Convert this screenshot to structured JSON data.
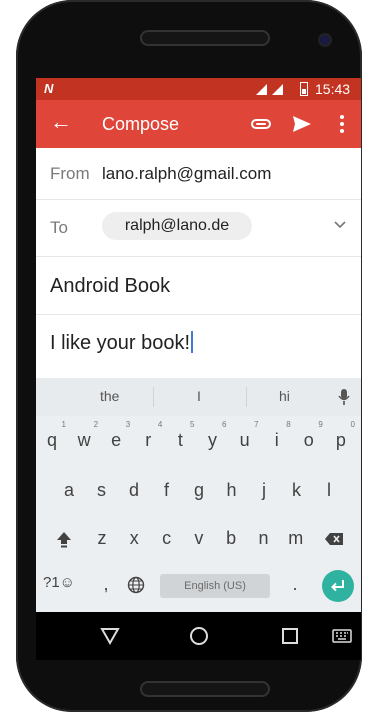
{
  "status_bar": {
    "notification": "N",
    "time": "15:43"
  },
  "app_bar": {
    "title": "Compose"
  },
  "compose": {
    "from_label": "From",
    "from_value": "lano.ralph@gmail.com",
    "to_label": "To",
    "to_chip": "ralph@lano.de",
    "subject": "Android Book",
    "body": "I like your book!"
  },
  "keyboard": {
    "suggestions": [
      "the",
      "I",
      "hi"
    ],
    "row1": [
      {
        "k": "q",
        "h": "1"
      },
      {
        "k": "w",
        "h": "2"
      },
      {
        "k": "e",
        "h": "3"
      },
      {
        "k": "r",
        "h": "4"
      },
      {
        "k": "t",
        "h": "5"
      },
      {
        "k": "y",
        "h": "6"
      },
      {
        "k": "u",
        "h": "7"
      },
      {
        "k": "i",
        "h": "8"
      },
      {
        "k": "o",
        "h": "9"
      },
      {
        "k": "p",
        "h": "0"
      }
    ],
    "row2": [
      "a",
      "s",
      "d",
      "f",
      "g",
      "h",
      "j",
      "k",
      "l"
    ],
    "row3": [
      "z",
      "x",
      "c",
      "v",
      "b",
      "n",
      "m"
    ],
    "symbols_key": "?1☺",
    "comma_key": ",",
    "space_label": "English (US)",
    "period_key": "."
  },
  "colors": {
    "status_bar": "#c23321",
    "app_bar": "#e0453a",
    "enter_key": "#2fb3a0"
  }
}
